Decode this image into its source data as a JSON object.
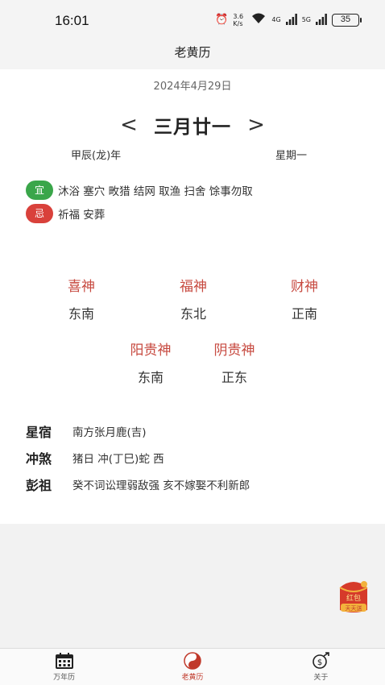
{
  "status_bar": {
    "time": "16:01",
    "net_speed": "3.6 K/s",
    "signal1": "4G",
    "signal2": "5G",
    "battery": "35"
  },
  "header": {
    "title": "老黄历"
  },
  "calendar": {
    "solar_date": "2024年4月29日",
    "lunar_date": "三月廿一",
    "ganzhi_year": "甲辰(龙)年",
    "weekday": "星期一",
    "prev_arrow": "<",
    "next_arrow": ">"
  },
  "yiji": {
    "yi_label": "宜",
    "yi_text": "沐浴 塞穴 畋猎 结网 取渔 扫舍 馀事勿取",
    "ji_label": "忌",
    "ji_text": "祈福 安葬",
    "yi_color": "#3aa64a",
    "ji_color": "#d9413b"
  },
  "gods": [
    {
      "name": "喜神",
      "direction": "东南"
    },
    {
      "name": "福神",
      "direction": "东北"
    },
    {
      "name": "财神",
      "direction": "正南"
    },
    {
      "name": "阳贵神",
      "direction": "东南"
    },
    {
      "name": "阴贵神",
      "direction": "正东"
    }
  ],
  "info": {
    "xingxiu_label": "星宿",
    "xingxiu_text": "南方张月鹿(吉)",
    "chongsha_label": "冲煞",
    "chongsha_text": "猪日 冲(丁巳)蛇 西",
    "pengzu_label": "彭祖",
    "pengzu_text": "癸不词讼理弱敌强 亥不嫁娶不利新郎"
  },
  "redpacket": {
    "text1": "红包",
    "text2": "天天送"
  },
  "nav": [
    {
      "label": "万年历",
      "icon": "calendar-icon"
    },
    {
      "label": "老黄历",
      "icon": "yin-yang-icon",
      "active": true
    },
    {
      "label": "关于",
      "icon": "money-icon"
    }
  ],
  "accent_color": "#c74a40"
}
